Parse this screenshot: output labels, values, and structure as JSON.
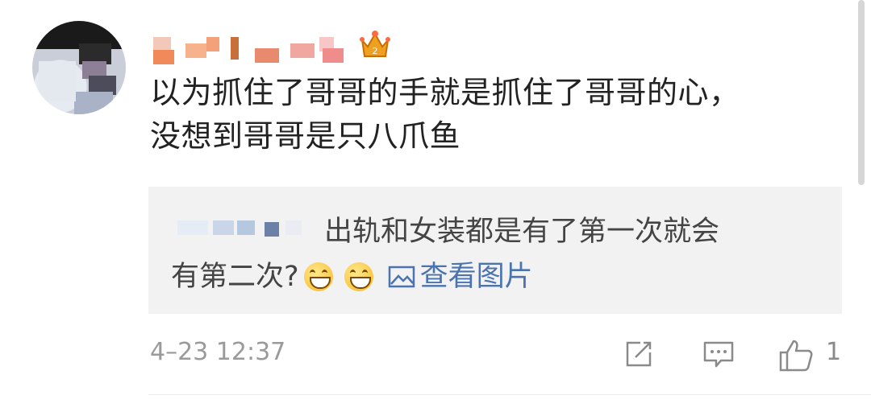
{
  "comment": {
    "text_lines": [
      "以为抓住了哥哥的手就是抓住了哥哥的心，",
      "没想到哥哥是只八爪鱼"
    ]
  },
  "quote": {
    "line1": "出轨和女装都是有了第一次就会",
    "line2": "有第二次?",
    "view_image_label": "查看图片"
  },
  "footer": {
    "timestamp": "4–23 12:37",
    "like_count": "1"
  },
  "icons": {
    "crown": "crown-badge-icon",
    "emoji": "grin-emoji-icon",
    "image": "image-icon",
    "share": "share-icon",
    "comment": "comment-icon",
    "like": "thumbs-up-icon"
  },
  "colors": {
    "link": "#4a73b0",
    "quote_bg": "#f2f2f2",
    "crown": "#f0a020"
  }
}
